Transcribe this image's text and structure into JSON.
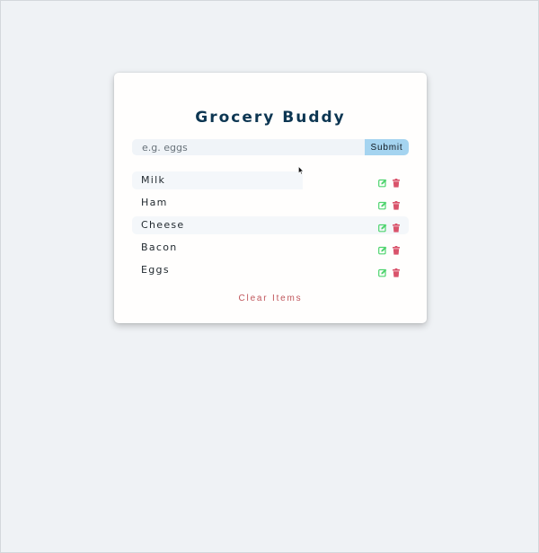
{
  "app": {
    "title": "Grocery Buddy"
  },
  "form": {
    "placeholder": "e.g. eggs",
    "value": "",
    "submit_label": "Submit"
  },
  "items": [
    {
      "name": "Milk"
    },
    {
      "name": "Ham"
    },
    {
      "name": "Cheese"
    },
    {
      "name": "Bacon"
    },
    {
      "name": "Eggs"
    }
  ],
  "clear_label": "Clear Items",
  "colors": {
    "title": "#0d3652",
    "submit_bg": "#a5d4f0",
    "edit_icon": "#4ed46e",
    "delete_icon": "#d9536b",
    "clear_text": "#c0565b"
  },
  "icons": {
    "edit": "edit-icon",
    "delete": "trash-icon"
  }
}
